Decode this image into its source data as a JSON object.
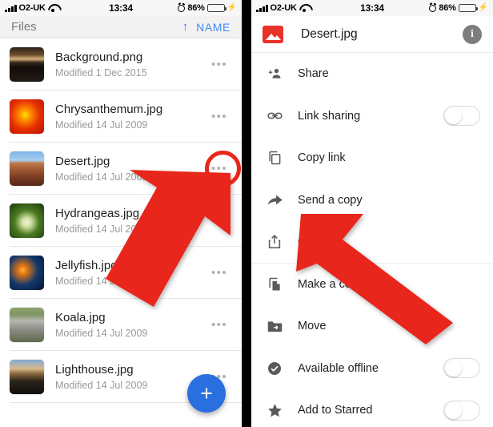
{
  "status_bar": {
    "signal_icon": "signal-bars-icon",
    "carrier": "O2-UK",
    "wifi_icon": "wifi-icon",
    "time": "13:34",
    "alarm_icon": "alarm-clock-icon",
    "battery_percent": "86%",
    "battery_icon": "battery-icon",
    "charging_icon": "lightning-bolt-icon",
    "battery_color": "#4cd964",
    "battery_level": 86
  },
  "left_panel": {
    "nav": {
      "title": "Files",
      "sort_arrow_icon": "arrow-up-icon",
      "sort_label": "NAME",
      "accent_color": "#3f8cf0"
    },
    "files": [
      {
        "name": "Background.png",
        "modified": "Modified 1 Dec 2015",
        "thumb": "th-background",
        "overflow_icon": "more-options-icon"
      },
      {
        "name": "Chrysanthemum.jpg",
        "modified": "Modified 14 Jul 2009",
        "thumb": "th-chrys",
        "overflow_icon": "more-options-icon"
      },
      {
        "name": "Desert.jpg",
        "modified": "Modified 14 Jul 2009",
        "thumb": "th-desert",
        "overflow_icon": "more-options-icon"
      },
      {
        "name": "Hydrangeas.jpg",
        "modified": "Modified 14 Jul 2009",
        "thumb": "th-hydra",
        "overflow_icon": "more-options-icon"
      },
      {
        "name": "Jellyfish.jpg",
        "modified": "Modified 14 Jul 2009",
        "thumb": "th-jelly",
        "overflow_icon": "more-options-icon"
      },
      {
        "name": "Koala.jpg",
        "modified": "Modified 14 Jul 2009",
        "thumb": "th-koala",
        "overflow_icon": "more-options-icon"
      },
      {
        "name": "Lighthouse.jpg",
        "modified": "Modified 14 Jul 2009",
        "thumb": "th-light",
        "overflow_icon": "more-options-icon"
      }
    ],
    "dots_glyph": "•••",
    "fab": {
      "icon": "plus-icon",
      "glyph": "+",
      "color": "#2a6fe0"
    },
    "annotations": {
      "highlight_color": "#e8261c",
      "circle_target": "Desert.jpg overflow menu",
      "arrow_icon": "red-arrow-icon"
    }
  },
  "right_panel": {
    "header": {
      "file_icon": "image-file-icon",
      "file_icon_color": "#e8322a",
      "title": "Desert.jpg",
      "info_icon": "info-icon",
      "info_glyph": "i"
    },
    "menu": [
      {
        "label": "Share",
        "icon": "add-person-icon",
        "toggle": null
      },
      {
        "label": "Link sharing",
        "icon": "link-icon",
        "toggle": "off"
      },
      {
        "label": "Copy link",
        "icon": "copy-icon",
        "toggle": null
      },
      {
        "label": "Send a copy",
        "icon": "share-arrow-icon",
        "toggle": null
      },
      {
        "label": "Open in",
        "icon": "open-in-icon",
        "toggle": null
      },
      {
        "label": "Make a copy",
        "icon": "duplicate-file-icon",
        "toggle": null
      },
      {
        "label": "Move",
        "icon": "move-folder-icon",
        "toggle": null
      },
      {
        "label": "Available offline",
        "icon": "offline-check-icon",
        "toggle": "off"
      },
      {
        "label": "Add to Starred",
        "icon": "star-icon",
        "toggle": "off"
      }
    ],
    "annotations": {
      "arrow_icon": "red-arrow-icon",
      "arrow_target": "Send a copy"
    }
  }
}
